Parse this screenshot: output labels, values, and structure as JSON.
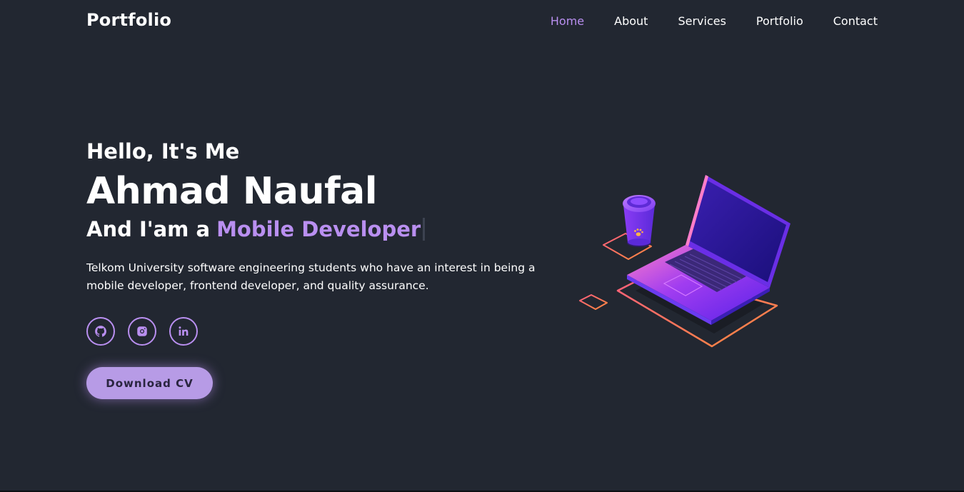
{
  "header": {
    "logo": "Portfolio",
    "nav": [
      "Home",
      "About",
      "Services",
      "Portfolio",
      "Contact"
    ],
    "active_nav": "Home"
  },
  "hero": {
    "greeting": "Hello, It's Me",
    "name": "Ahmad Naufal",
    "role_prefix": "And I'am a",
    "role_highlight": "Mobile Developer",
    "description": "Telkom University software engineering students who have an interest in being a mobile developer, frontend developer, and quality assurance.",
    "socials": [
      "github-icon",
      "instagram-icon",
      "linkedin-icon"
    ],
    "cta_label": "Download CV"
  },
  "colors": {
    "background": "#222731",
    "accent": "#b98ff0",
    "button": "#b79be6"
  }
}
